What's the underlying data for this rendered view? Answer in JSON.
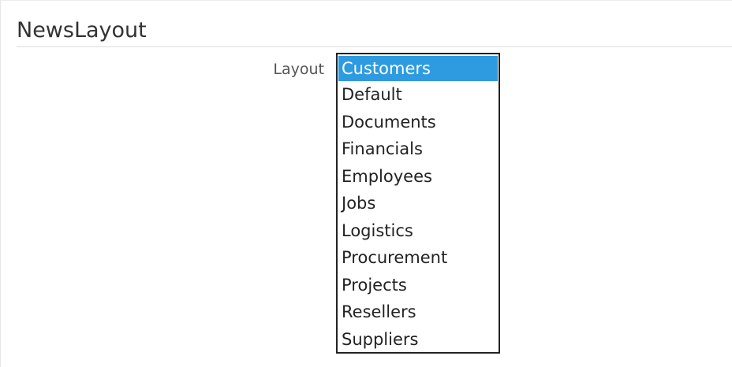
{
  "section": {
    "title": "NewsLayout"
  },
  "layout_field": {
    "label": "Layout",
    "selected_index": 0,
    "options": [
      "Customers",
      "Default",
      "Documents",
      "Financials",
      "Employees",
      "Jobs",
      "Logistics",
      "Procurement",
      "Projects",
      "Resellers",
      "Suppliers"
    ]
  },
  "colors": {
    "selection_background": "#2e9be0",
    "selection_text": "#ffffff",
    "listbox_border": "#222222"
  }
}
